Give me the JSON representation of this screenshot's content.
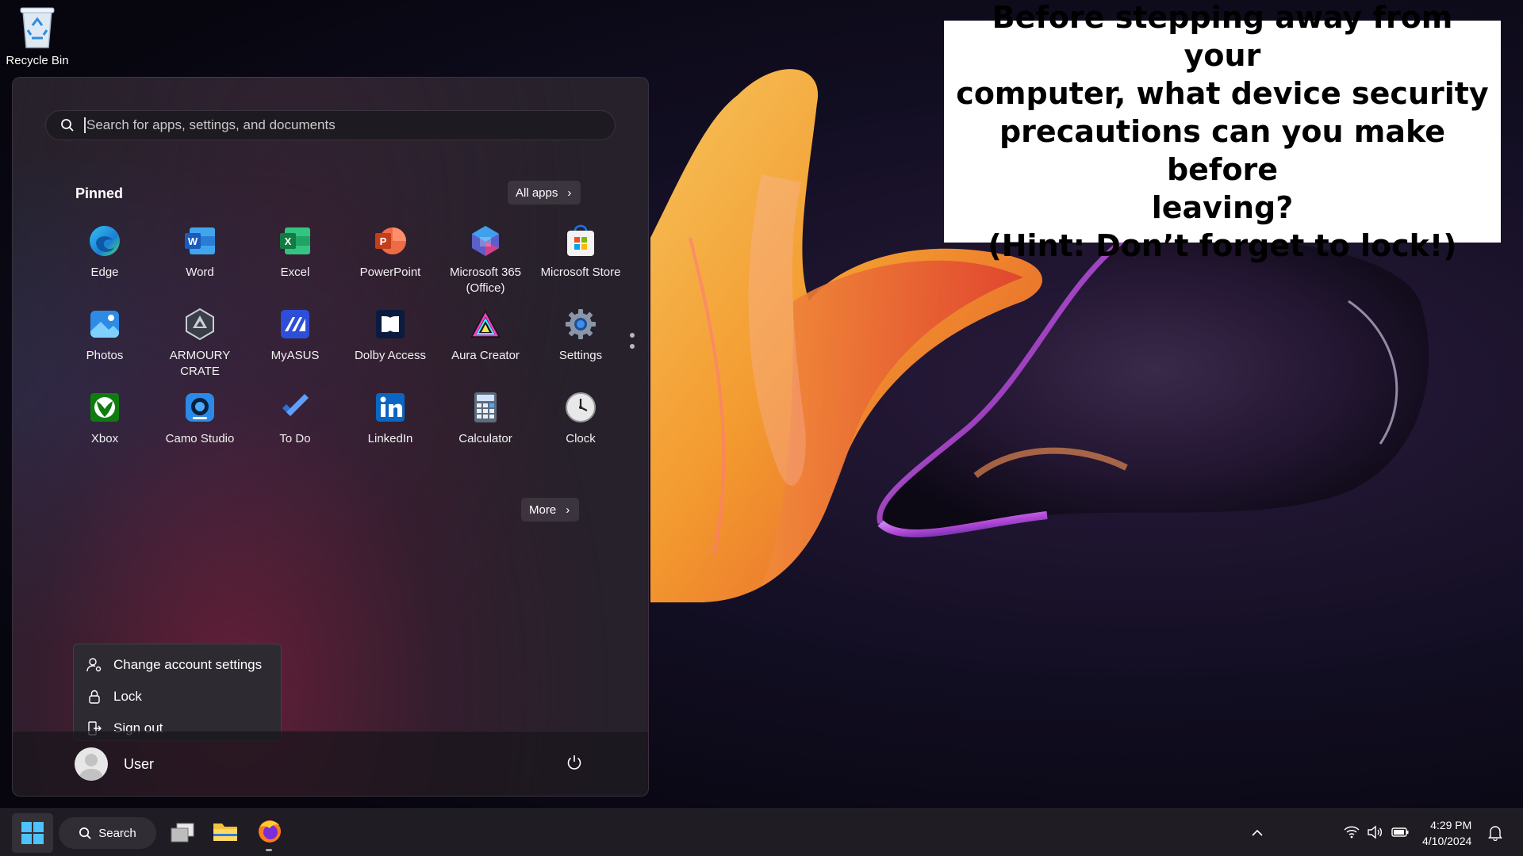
{
  "desktop": {
    "recycle_bin_label": "Recycle Bin"
  },
  "annotation": {
    "lines": [
      "Before stepping away from your",
      "computer, what device security",
      "precautions can you make before",
      "leaving?",
      "(Hint: Don’t forget to lock!)"
    ]
  },
  "start_menu": {
    "search_placeholder": "Search for apps, settings, and documents",
    "pinned_title": "Pinned",
    "all_apps_label": "All apps",
    "more_label": "More",
    "apps": [
      {
        "label": "Edge",
        "icon": "edge-icon"
      },
      {
        "label": "Word",
        "icon": "word-icon"
      },
      {
        "label": "Excel",
        "icon": "excel-icon"
      },
      {
        "label": "PowerPoint",
        "icon": "powerpoint-icon"
      },
      {
        "label": "Microsoft 365 (Office)",
        "icon": "m365-icon"
      },
      {
        "label": "Microsoft Store",
        "icon": "store-icon"
      },
      {
        "label": "Photos",
        "icon": "photos-icon"
      },
      {
        "label": "ARMOURY CRATE",
        "icon": "armoury-crate-icon"
      },
      {
        "label": "MyASUS",
        "icon": "myasus-icon"
      },
      {
        "label": "Dolby Access",
        "icon": "dolby-icon"
      },
      {
        "label": "Aura Creator",
        "icon": "aura-creator-icon"
      },
      {
        "label": "Settings",
        "icon": "settings-gear-icon"
      },
      {
        "label": "Xbox",
        "icon": "xbox-icon"
      },
      {
        "label": "Camo Studio",
        "icon": "camo-studio-icon"
      },
      {
        "label": "To Do",
        "icon": "todo-check-icon"
      },
      {
        "label": "LinkedIn",
        "icon": "linkedin-icon"
      },
      {
        "label": "Calculator",
        "icon": "calculator-icon"
      },
      {
        "label": "Clock",
        "icon": "clock-icon"
      }
    ],
    "account_menu": [
      {
        "label": "Change account settings",
        "icon": "account-settings-icon"
      },
      {
        "label": "Lock",
        "icon": "lock-icon"
      },
      {
        "label": "Sign out",
        "icon": "sign-out-icon"
      }
    ],
    "user_name": "User"
  },
  "taskbar": {
    "search_label": "Search",
    "time": "4:29 PM",
    "date": "4/10/2024"
  }
}
